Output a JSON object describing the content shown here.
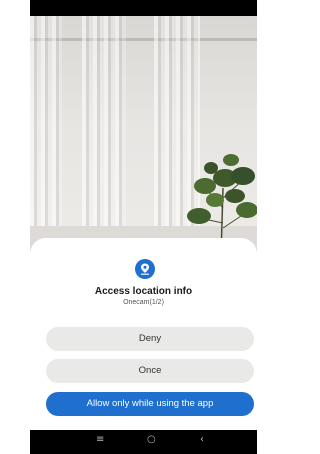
{
  "dialog": {
    "icon": "location-pin-icon",
    "title": "Access location info",
    "subtitle": "Onecam(1/2)",
    "deny_label": "Deny",
    "once_label": "Once",
    "allow_label": "Allow only while using the app"
  },
  "nav": {
    "recent_icon": "recent-apps-icon",
    "home_icon": "home-icon",
    "back_icon": "back-icon",
    "recent_glyph": "≡",
    "home_glyph": "○",
    "back_glyph": "‹"
  },
  "colors": {
    "accent": "#1f6fcf",
    "button_gray": "#e9e9e7",
    "bars": "#000000"
  }
}
